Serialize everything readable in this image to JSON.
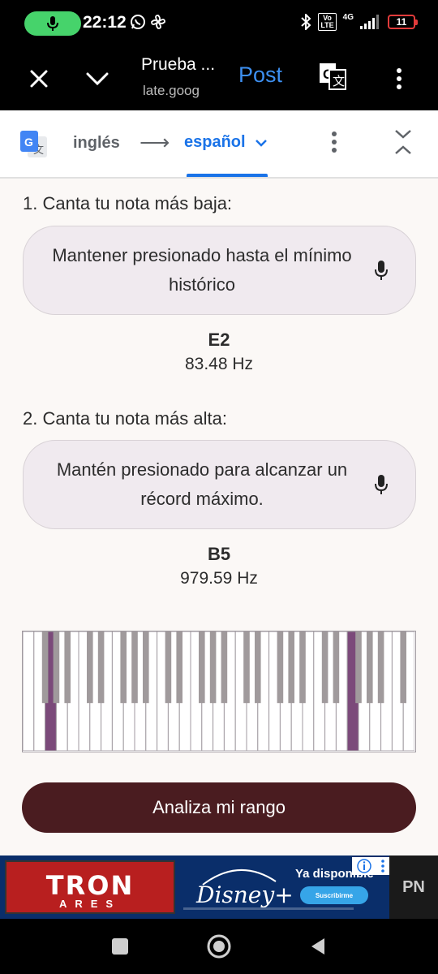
{
  "status_bar": {
    "time": "22:12",
    "network": "4G",
    "volte": "Vo\nLTE",
    "battery": "11"
  },
  "browser": {
    "page_title": "Prueba ...",
    "page_url": "late.goog",
    "post_label": "Post"
  },
  "translate_bar": {
    "source_language": "inglés",
    "target_language": "español"
  },
  "content": {
    "lowest_prompt": "1. Canta tu nota más baja:",
    "lowest_field_text": "Mantener presionado hasta el mínimo histórico",
    "lowest_note": "E2",
    "lowest_freq": "83.48 Hz",
    "highest_prompt": "2. Canta tu nota más alta:",
    "highest_field_text": "Mantén presionado para alcanzar un récord máximo.",
    "highest_note": "B5",
    "highest_freq": "979.59 Hz",
    "analyze_button": "Analiza mi rango"
  },
  "piano": {
    "white_key_count": 35,
    "highlighted_white_keys": [
      2,
      29
    ],
    "highlight_color": "#7b4a7a",
    "black_key_color": "#a09a9c"
  },
  "ad": {
    "tron_title": "TRON",
    "tron_subtitle": "ARES",
    "disney_logo": "Disney+",
    "promo_text": "Ya disponible",
    "cta": "Suscribirme",
    "right_label": "PN"
  },
  "colors": {
    "accent_blue": "#1a73e8",
    "button_dark": "#4a1c20",
    "mic_green": "#46d36b"
  }
}
